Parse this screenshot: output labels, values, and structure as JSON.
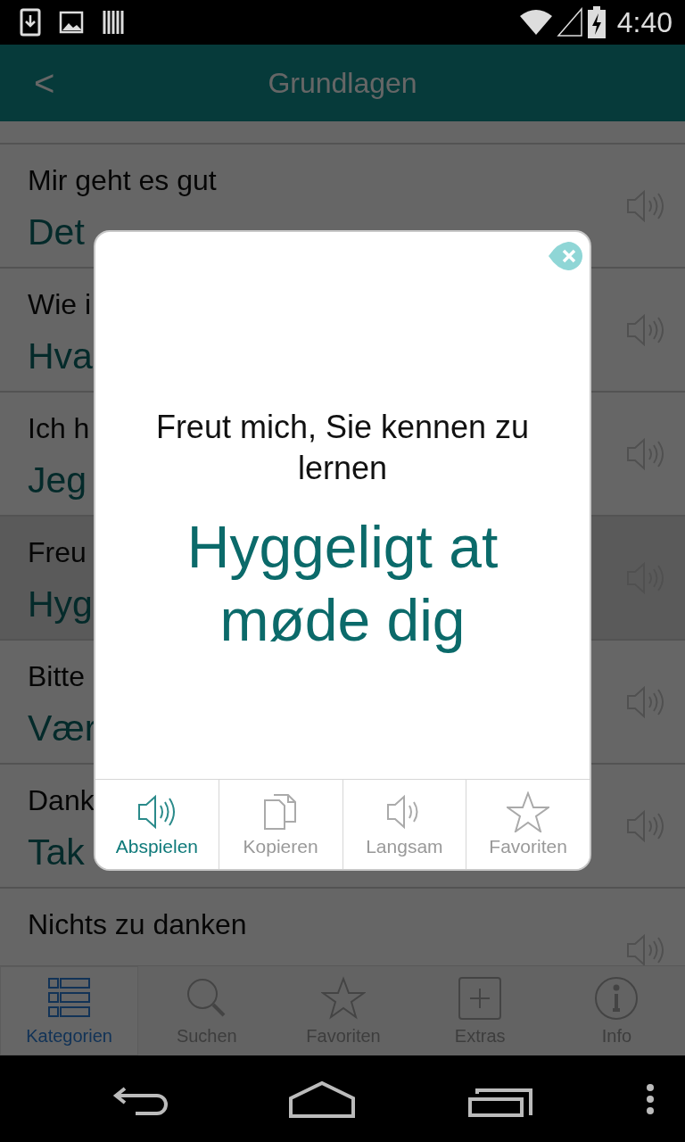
{
  "status_bar": {
    "time": "4:40"
  },
  "header": {
    "back": "<",
    "title": "Grundlagen"
  },
  "list": [
    {
      "german": "Mir geht es gut",
      "danish": "Det",
      "selected": false
    },
    {
      "german": "Wie i",
      "danish": "Hva",
      "selected": false
    },
    {
      "german": "Ich h",
      "danish": "Jeg",
      "selected": false
    },
    {
      "german": "Freu",
      "danish": "Hyg",
      "selected": true
    },
    {
      "german": "Bitte",
      "danish": "Vær",
      "selected": false
    },
    {
      "german": "Dank",
      "danish": "Tak",
      "selected": false
    },
    {
      "german": "Nichts zu danken",
      "selected": false
    }
  ],
  "dialog": {
    "german": "Freut mich, Sie kennen zu lernen",
    "danish": "Hyggeligt at møde dig",
    "actions": [
      {
        "label": "Abspielen",
        "kind": "play",
        "selected": true
      },
      {
        "label": "Kopieren",
        "kind": "copy",
        "selected": false
      },
      {
        "label": "Langsam",
        "kind": "slow",
        "selected": false
      },
      {
        "label": "Favoriten",
        "kind": "star",
        "selected": false
      }
    ]
  },
  "tabs": [
    {
      "label": "Kategorien",
      "kind": "list",
      "selected": true
    },
    {
      "label": "Suchen",
      "kind": "search",
      "selected": false
    },
    {
      "label": "Favoriten",
      "kind": "star",
      "selected": false
    },
    {
      "label": "Extras",
      "kind": "plus",
      "selected": false
    },
    {
      "label": "Info",
      "kind": "info",
      "selected": false
    }
  ]
}
